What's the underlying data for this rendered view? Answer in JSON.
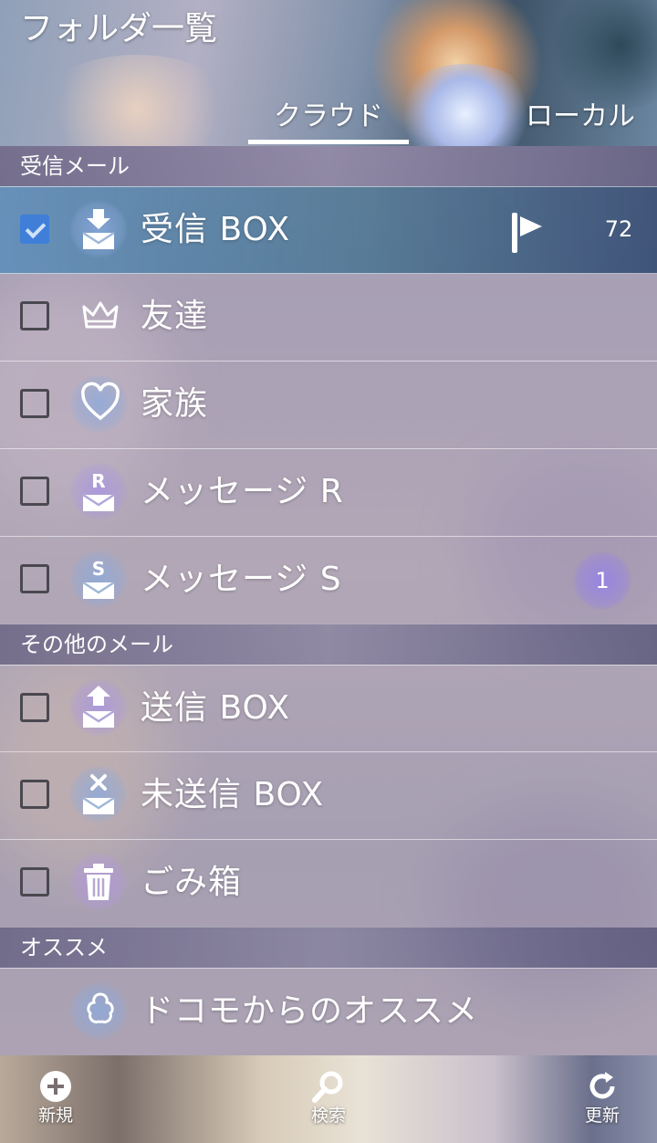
{
  "header": {
    "title": "フォルダ一覧",
    "tabs": [
      {
        "label": "クラウド",
        "selected": true
      },
      {
        "label": "ローカル",
        "selected": false
      }
    ]
  },
  "sections": [
    {
      "title": "受信メール",
      "folders": [
        {
          "label": "受信 BOX",
          "icon": "inbox-icon",
          "checked": true,
          "badge": "72",
          "flag_icon": "flag-icon",
          "active": true
        },
        {
          "label": "友達",
          "icon": "crown-icon",
          "checked": false
        },
        {
          "label": "家族",
          "icon": "heart-icon",
          "checked": false
        },
        {
          "label": "メッセージ R",
          "icon": "message-r-icon",
          "icon_letter": "R",
          "checked": false
        },
        {
          "label": "メッセージ S",
          "icon": "message-s-icon",
          "icon_letter": "S",
          "checked": false,
          "badge": "1"
        }
      ]
    },
    {
      "title": "その他のメール",
      "folders": [
        {
          "label": "送信 BOX",
          "icon": "outbox-icon",
          "checked": false
        },
        {
          "label": "未送信 BOX",
          "icon": "unsent-icon",
          "checked": false
        },
        {
          "label": "ごみ箱",
          "icon": "trash-icon",
          "checked": false
        }
      ]
    },
    {
      "title": "オススメ",
      "folders": [
        {
          "label": "ドコモからのオススメ",
          "icon": "flower-icon"
        }
      ]
    }
  ],
  "footer": {
    "new_label": "新規",
    "search_label": "検索",
    "refresh_label": "更新"
  },
  "colors": {
    "accent": "#3f7fd8",
    "active_row": "#4a7ea0",
    "section_bg": "#615c80",
    "badge_purple": "#9682e6"
  }
}
